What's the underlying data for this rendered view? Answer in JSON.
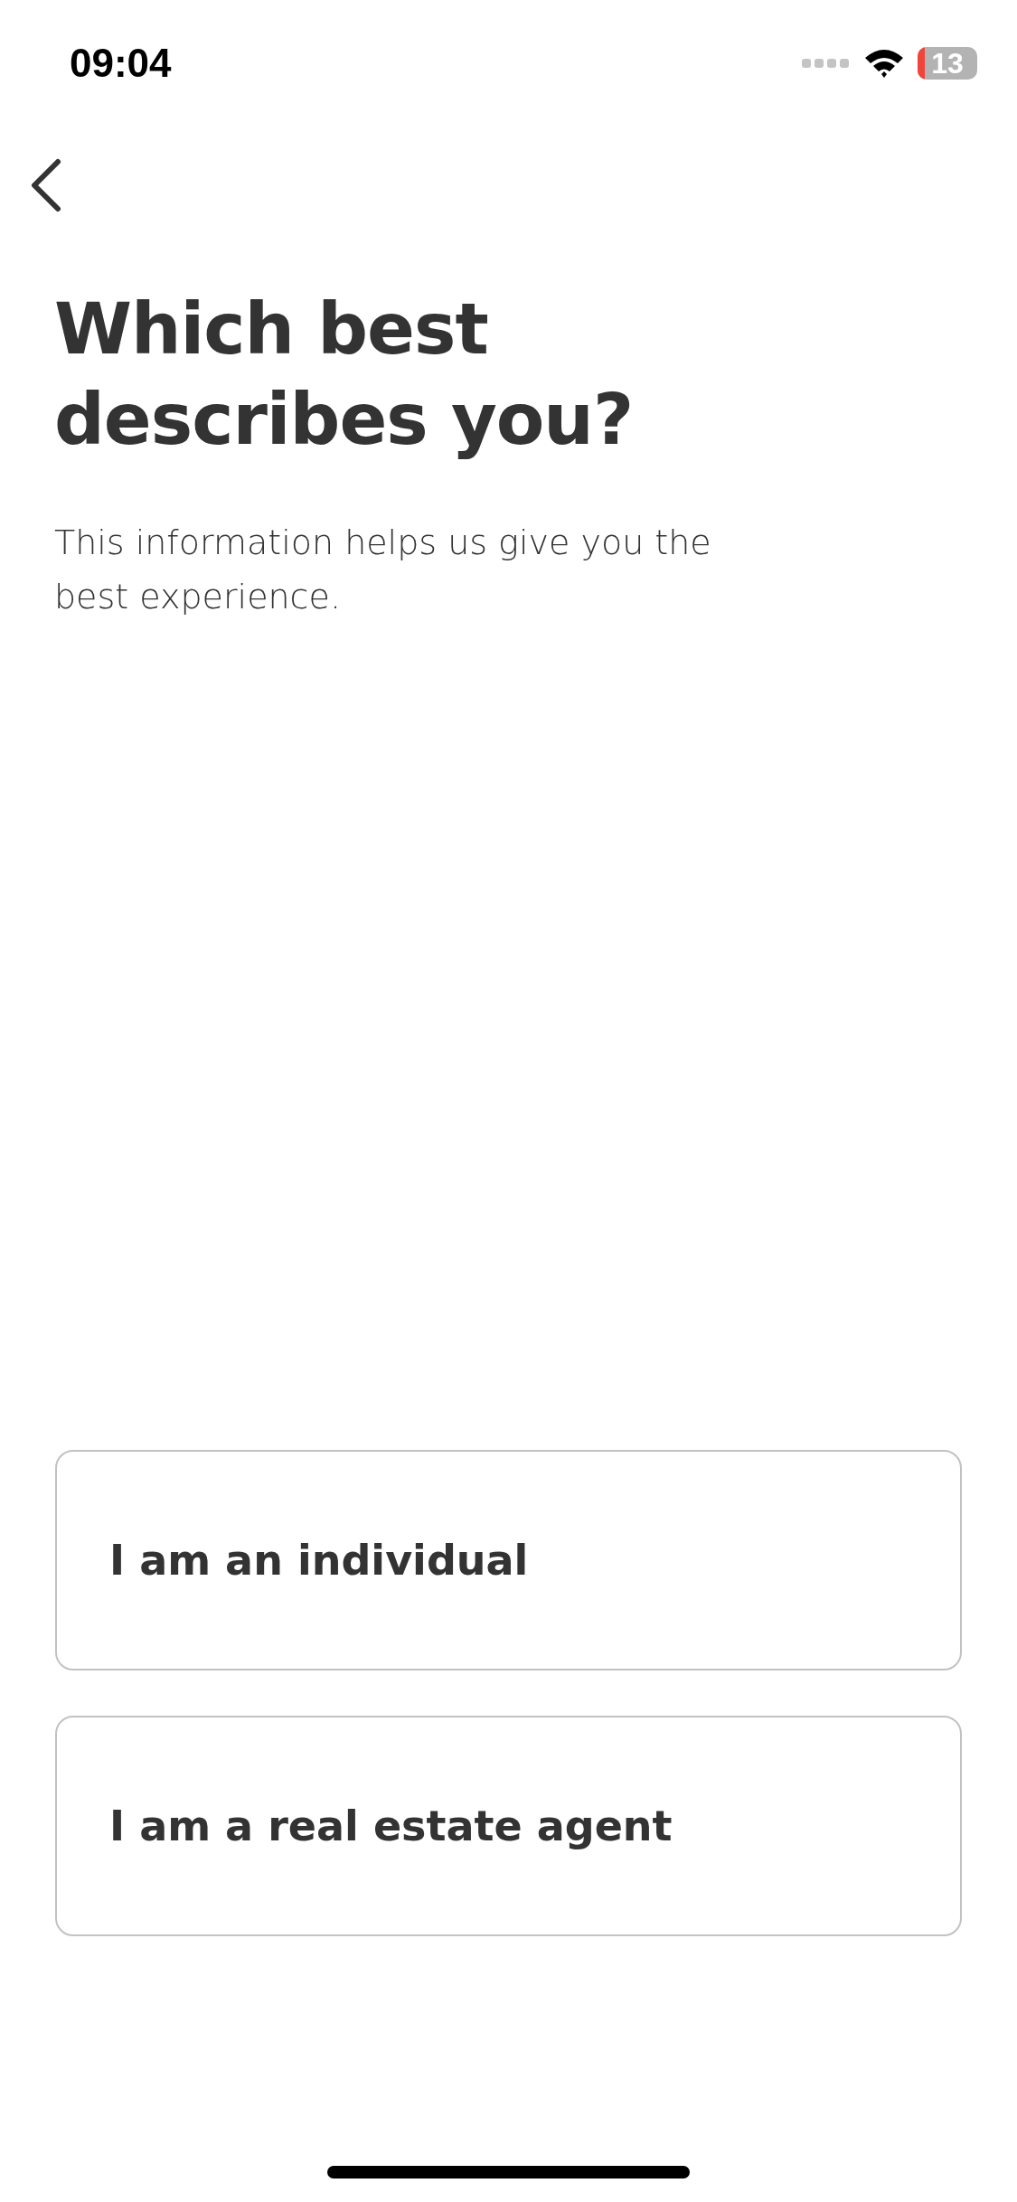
{
  "status_bar": {
    "time": "09:04",
    "battery": "13"
  },
  "title": "Which best describes you?",
  "subtitle": "This information helps us give you the best experience.",
  "options": [
    {
      "label": "I am an individual",
      "selected": false
    },
    {
      "label": "I am a real estate agent",
      "selected": false
    }
  ]
}
